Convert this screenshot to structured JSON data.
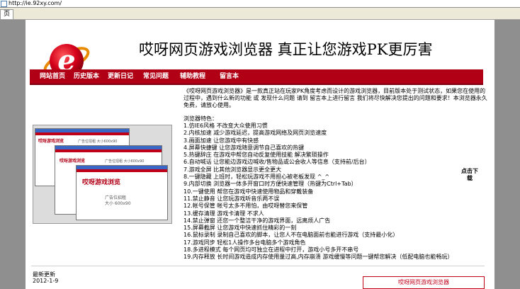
{
  "browser": {
    "address": "http://ie.92xy.com/",
    "tab_label": "页"
  },
  "header": {
    "logo_letter": "e",
    "headline": "哎呀网页游戏浏览器  真正让您游戏PK更厉害"
  },
  "nav": {
    "items": [
      "网站首页",
      "历史版本",
      "更新日记",
      "常见问题",
      "辅助教程",
      "留言本"
    ]
  },
  "screenshot": {
    "app_name": "哎呀游戏浏览",
    "ad_text": "广告位招租  大小600x90",
    "ad_text2": "广告位招租",
    "ad_text3": "大小 600x90"
  },
  "intro": "《哎呀网页游戏浏览器》是一款真正站在玩家PK角度考虑而设计的游戏浏览器，目前版本处于测试状态，如果您在使用的过程中，遇到什么新的功能 或 发现什么问题 请到 留言本上进行留言 我们将尽快解决您提出的问题和要求！本浏览器永久免费，请放心使用。",
  "features_title": "浏览器特色：",
  "features": [
    "1.仿IE6风格  不改变大众使用习惯",
    "2.内核加速  减少游戏延迟，提高游戏网络及网页浏览速度",
    "3.画面加速  让您游戏中有快感",
    "4.屏幕快捷键  让您游戏随意调节自己喜欢的热键",
    "5.热键辞庄  在游戏中帮您自动反复使用技能  解决繁琐操作",
    "6.自动喊话  让您能边游戏边喊收/售物品或公会收人等信息（支持前/后台）",
    "7.游戏全屏  比其他浏览器显示更全更大",
    "8.一键隐藏  上班时，轻松玩游戏不用担心被老板发现  ^_^",
    "9.内部切换  浏览器一体多开窗口时方便快速管理（热键为Ctrl+Tab）",
    "10.一键使用  帮您在游戏中快速使用物品和穿戴装备",
    "11.禁止静音  让您玩游戏听音乐两不误",
    "12.帐号保管  帐号太多不用怕，由哎呀替您来保管",
    "13.缓存清理  游戏卡清理  不求人",
    "14.禁止弹窗  还您一个整洁干净的游戏界面，远离烦人广告",
    "15.屏幕截屏  让您游戏中快速抓住精彩的一刻",
    "16.鼠标录制  录制自己喜欢的脚本，让您人不在电脑面前也能进行游戏（支持最小化）",
    "17.游戏同步  轻松1人操作多台电脑多个游戏角色",
    "18.多进程模式  每个网页均可独立在进程中打开，游戏小号多开不串号",
    "19.内存释放  长时间游戏造成内存使用量过高,内存崩溃 游戏缓慢等问题一键帮您解决（低配电脑也能畅玩）"
  ],
  "download": "点击下载",
  "news": {
    "title": "最新更新",
    "date": "2012-1-9"
  },
  "promo": "哎呀网页游戏浏览器"
}
